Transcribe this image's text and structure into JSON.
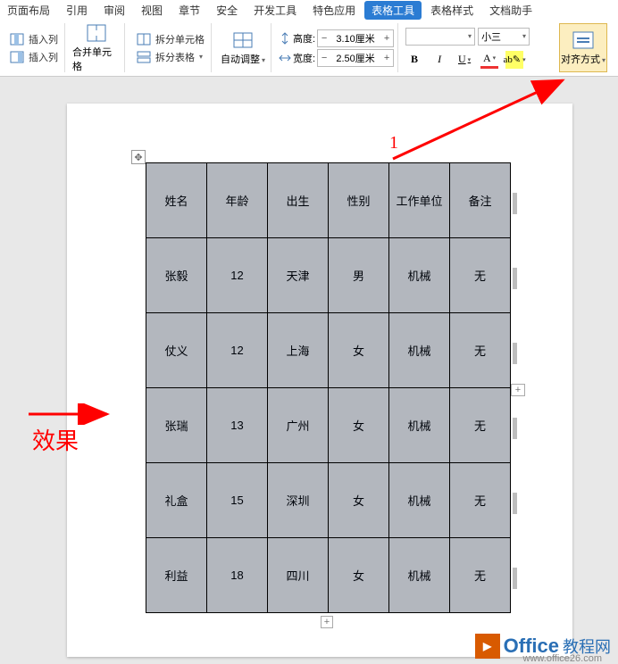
{
  "menu": {
    "items": [
      "页面布局",
      "引用",
      "审阅",
      "视图",
      "章节",
      "安全",
      "开发工具",
      "特色应用",
      "表格工具",
      "表格样式",
      "文档助手"
    ],
    "active_index": 8
  },
  "ribbon": {
    "insert_col1": "插入列",
    "insert_col2": "插入列",
    "merge_cells": "合并单元格",
    "split_cells": "拆分单元格",
    "split_table": "拆分表格",
    "autofit": "自动调整",
    "height_label": "高度:",
    "width_label": "宽度:",
    "height_value": "3.10厘米",
    "width_value": "2.50厘米",
    "font_name": "",
    "font_size": "小三",
    "align": "对齐方式"
  },
  "format_buttons": {
    "bold": "B",
    "italic": "I",
    "underline": "U",
    "font_color": "A",
    "highlight": "ab"
  },
  "table": {
    "headers": [
      "姓名",
      "年龄",
      "出生",
      "性别",
      "工作单位",
      "备注"
    ],
    "rows": [
      [
        "张毅",
        "12",
        "天津",
        "男",
        "机械",
        "无"
      ],
      [
        "仗义",
        "12",
        "上海",
        "女",
        "机械",
        "无"
      ],
      [
        "张瑞",
        "13",
        "广州",
        "女",
        "机械",
        "无"
      ],
      [
        "礼盒",
        "15",
        "深圳",
        "女",
        "机械",
        "无"
      ],
      [
        "利益",
        "18",
        "四川",
        "女",
        "机械",
        "无"
      ]
    ]
  },
  "annotations": {
    "num1": "1",
    "effect": "效果"
  },
  "watermark": {
    "brand": "Office",
    "suffix": "教程网",
    "url": "www.office26.com"
  }
}
